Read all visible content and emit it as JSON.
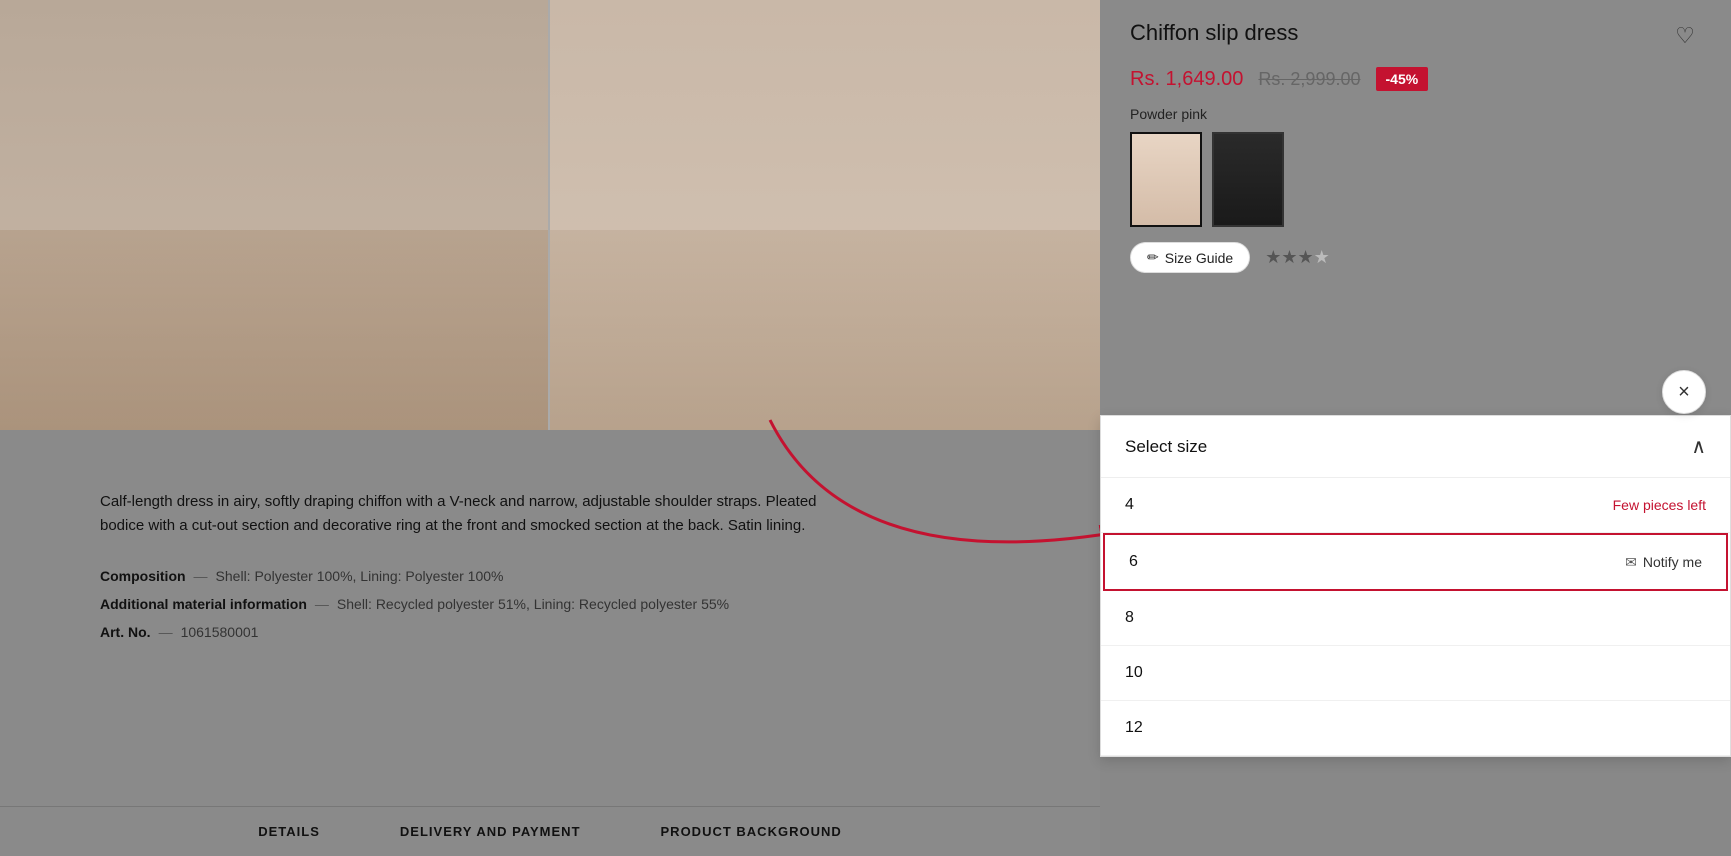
{
  "product": {
    "title": "Chiffon slip dress",
    "price_current": "Rs. 1,649.00",
    "price_original": "Rs. 2,999.00",
    "discount": "-45%",
    "color_label": "Powder pink",
    "rating_stars": 3.5,
    "description": "Calf-length dress in airy, softly draping chiffon with a V-neck and narrow, adjustable shoulder straps. Pleated bodice with a cut-out section and decorative ring at the front and smocked section at the back. Satin lining.",
    "composition_label": "Composition",
    "composition_value": "Shell: Polyester 100%, Lining: Polyester 100%",
    "material_info_label": "Additional material information",
    "material_info_value": "Shell: Recycled polyester 51%, Lining: Recycled polyester 55%",
    "art_no_label": "Art. No.",
    "art_no_value": "1061580001"
  },
  "size_guide": {
    "button_label": "Size Guide"
  },
  "size_selector": {
    "title": "Select size",
    "sizes": [
      {
        "number": "4",
        "status": "few_pieces_left",
        "status_text": "Few pieces left",
        "notify": false
      },
      {
        "number": "6",
        "status": "out_of_stock",
        "notify": true,
        "notify_label": "Notify me",
        "highlighted": true
      },
      {
        "number": "8",
        "status": "available",
        "notify": false
      },
      {
        "number": "10",
        "status": "available",
        "notify": false
      },
      {
        "number": "12",
        "status": "available",
        "notify": false
      }
    ]
  },
  "tabs": {
    "items": [
      {
        "label": "DETAILS"
      },
      {
        "label": "DELIVERY AND PAYMENT"
      },
      {
        "label": "PRODUCT BACKGROUND"
      }
    ]
  },
  "icons": {
    "heart": "♡",
    "pencil": "✏",
    "chevron_up": "∧",
    "close": "×",
    "mail": "✉"
  }
}
